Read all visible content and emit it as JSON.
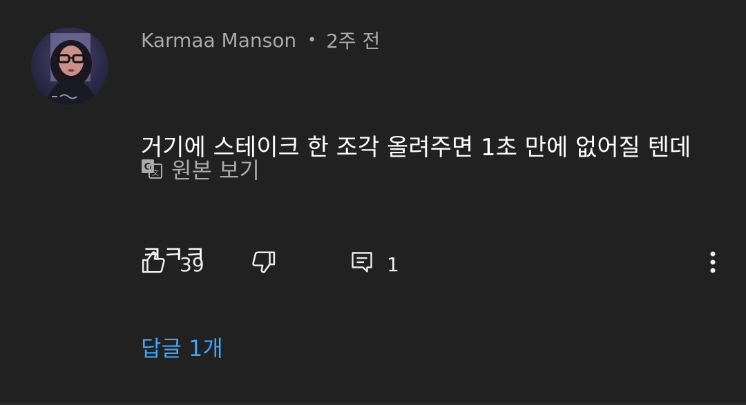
{
  "comment": {
    "author": "Karmaa Manson",
    "separator": "•",
    "time_ago": "2주 전",
    "text_line1": "거기에 스테이크 한 조각 올려주면 1초 만에 없어질 텐데",
    "text_line2": "ㅋㅋㅋ",
    "translate_label": "원본 보기",
    "like_count": "39",
    "reply_count": "1",
    "replies_link": "답글 1개"
  },
  "icons": {
    "avatar": "avatar",
    "translate": "translate-icon",
    "like": "thumbs-up-icon",
    "dislike": "thumbs-down-icon",
    "reply": "comment-icon",
    "more": "more-vert-icon"
  },
  "colors": {
    "background": "#212121",
    "text_primary": "#ffffff",
    "text_secondary": "#aaaaaa",
    "link": "#3ea6ff"
  }
}
